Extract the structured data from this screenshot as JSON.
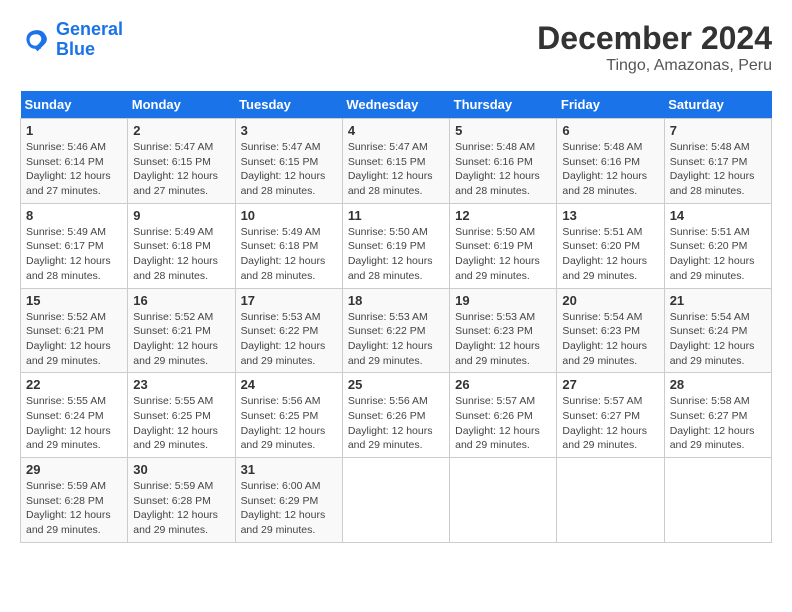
{
  "header": {
    "logo_line1": "General",
    "logo_line2": "Blue",
    "title": "December 2024",
    "subtitle": "Tingo, Amazonas, Peru"
  },
  "calendar": {
    "days_of_week": [
      "Sunday",
      "Monday",
      "Tuesday",
      "Wednesday",
      "Thursday",
      "Friday",
      "Saturday"
    ],
    "weeks": [
      [
        {
          "day": "1",
          "sunrise": "5:46 AM",
          "sunset": "6:14 PM",
          "daylight": "12 hours and 27 minutes."
        },
        {
          "day": "2",
          "sunrise": "5:47 AM",
          "sunset": "6:15 PM",
          "daylight": "12 hours and 27 minutes."
        },
        {
          "day": "3",
          "sunrise": "5:47 AM",
          "sunset": "6:15 PM",
          "daylight": "12 hours and 28 minutes."
        },
        {
          "day": "4",
          "sunrise": "5:47 AM",
          "sunset": "6:15 PM",
          "daylight": "12 hours and 28 minutes."
        },
        {
          "day": "5",
          "sunrise": "5:48 AM",
          "sunset": "6:16 PM",
          "daylight": "12 hours and 28 minutes."
        },
        {
          "day": "6",
          "sunrise": "5:48 AM",
          "sunset": "6:16 PM",
          "daylight": "12 hours and 28 minutes."
        },
        {
          "day": "7",
          "sunrise": "5:48 AM",
          "sunset": "6:17 PM",
          "daylight": "12 hours and 28 minutes."
        }
      ],
      [
        {
          "day": "8",
          "sunrise": "5:49 AM",
          "sunset": "6:17 PM",
          "daylight": "12 hours and 28 minutes."
        },
        {
          "day": "9",
          "sunrise": "5:49 AM",
          "sunset": "6:18 PM",
          "daylight": "12 hours and 28 minutes."
        },
        {
          "day": "10",
          "sunrise": "5:49 AM",
          "sunset": "6:18 PM",
          "daylight": "12 hours and 28 minutes."
        },
        {
          "day": "11",
          "sunrise": "5:50 AM",
          "sunset": "6:19 PM",
          "daylight": "12 hours and 28 minutes."
        },
        {
          "day": "12",
          "sunrise": "5:50 AM",
          "sunset": "6:19 PM",
          "daylight": "12 hours and 29 minutes."
        },
        {
          "day": "13",
          "sunrise": "5:51 AM",
          "sunset": "6:20 PM",
          "daylight": "12 hours and 29 minutes."
        },
        {
          "day": "14",
          "sunrise": "5:51 AM",
          "sunset": "6:20 PM",
          "daylight": "12 hours and 29 minutes."
        }
      ],
      [
        {
          "day": "15",
          "sunrise": "5:52 AM",
          "sunset": "6:21 PM",
          "daylight": "12 hours and 29 minutes."
        },
        {
          "day": "16",
          "sunrise": "5:52 AM",
          "sunset": "6:21 PM",
          "daylight": "12 hours and 29 minutes."
        },
        {
          "day": "17",
          "sunrise": "5:53 AM",
          "sunset": "6:22 PM",
          "daylight": "12 hours and 29 minutes."
        },
        {
          "day": "18",
          "sunrise": "5:53 AM",
          "sunset": "6:22 PM",
          "daylight": "12 hours and 29 minutes."
        },
        {
          "day": "19",
          "sunrise": "5:53 AM",
          "sunset": "6:23 PM",
          "daylight": "12 hours and 29 minutes."
        },
        {
          "day": "20",
          "sunrise": "5:54 AM",
          "sunset": "6:23 PM",
          "daylight": "12 hours and 29 minutes."
        },
        {
          "day": "21",
          "sunrise": "5:54 AM",
          "sunset": "6:24 PM",
          "daylight": "12 hours and 29 minutes."
        }
      ],
      [
        {
          "day": "22",
          "sunrise": "5:55 AM",
          "sunset": "6:24 PM",
          "daylight": "12 hours and 29 minutes."
        },
        {
          "day": "23",
          "sunrise": "5:55 AM",
          "sunset": "6:25 PM",
          "daylight": "12 hours and 29 minutes."
        },
        {
          "day": "24",
          "sunrise": "5:56 AM",
          "sunset": "6:25 PM",
          "daylight": "12 hours and 29 minutes."
        },
        {
          "day": "25",
          "sunrise": "5:56 AM",
          "sunset": "6:26 PM",
          "daylight": "12 hours and 29 minutes."
        },
        {
          "day": "26",
          "sunrise": "5:57 AM",
          "sunset": "6:26 PM",
          "daylight": "12 hours and 29 minutes."
        },
        {
          "day": "27",
          "sunrise": "5:57 AM",
          "sunset": "6:27 PM",
          "daylight": "12 hours and 29 minutes."
        },
        {
          "day": "28",
          "sunrise": "5:58 AM",
          "sunset": "6:27 PM",
          "daylight": "12 hours and 29 minutes."
        }
      ],
      [
        {
          "day": "29",
          "sunrise": "5:59 AM",
          "sunset": "6:28 PM",
          "daylight": "12 hours and 29 minutes."
        },
        {
          "day": "30",
          "sunrise": "5:59 AM",
          "sunset": "6:28 PM",
          "daylight": "12 hours and 29 minutes."
        },
        {
          "day": "31",
          "sunrise": "6:00 AM",
          "sunset": "6:29 PM",
          "daylight": "12 hours and 29 minutes."
        },
        null,
        null,
        null,
        null
      ]
    ]
  }
}
